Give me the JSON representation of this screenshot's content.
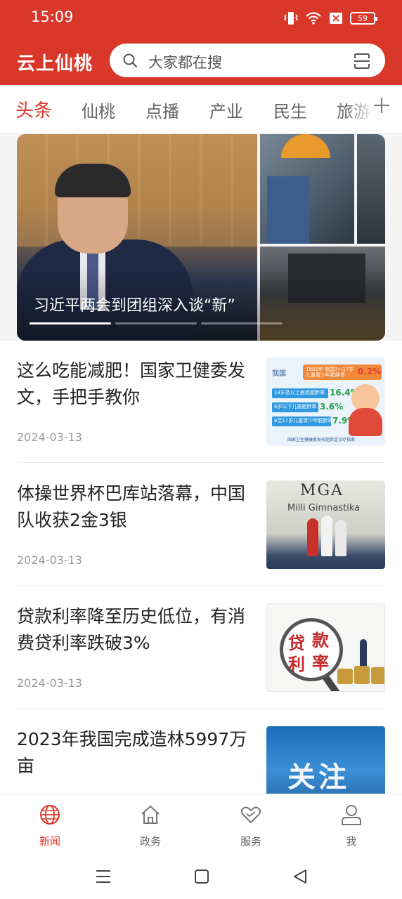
{
  "status_bar": {
    "time": "15:09",
    "battery": "59",
    "icons": [
      "vibrate-icon",
      "wifi-icon",
      "sim-off-icon",
      "battery-icon"
    ]
  },
  "header": {
    "app_title": "云上仙桃",
    "search_placeholder": "大家都在搜",
    "colors": {
      "brand": "#d8372a"
    }
  },
  "tabs": {
    "items": [
      "头条",
      "仙桃",
      "点播",
      "产业",
      "民生",
      "旅游"
    ],
    "active_index": 0
  },
  "carousel": {
    "caption": "习近平两会到团组深入谈“新”",
    "slide_count": 3,
    "active_slide": 0
  },
  "news": [
    {
      "title": "这么吃能减肥！国家卫健委发文，手把手教你",
      "date": "2024-03-13",
      "thumb": {
        "label": "我国",
        "header": "1982年 我国7～17岁儿童青少年肥胖率",
        "header_value": "0.2%",
        "rows": [
          {
            "label": "18岁及以上居民肥胖率",
            "value": "16.4%"
          },
          {
            "label": "6岁以下儿童肥胖率",
            "value": "3.6%"
          },
          {
            "label": "6至17岁儿童青少年肥胖率",
            "value": "7.9%"
          }
        ],
        "footer": "国家卫生健康委发布肥胖症诊疗指南"
      }
    },
    {
      "title": "体操世界杯巴库站落幕，中国队收获2金3银",
      "date": "2024-03-13",
      "thumb": {
        "logo": "MGA",
        "subtitle": "Milli Gimnastika"
      }
    },
    {
      "title": "贷款利率降至历史低位，有消费贷利率跌破3%",
      "date": "2024-03-13",
      "thumb": {
        "chars": [
          "贷",
          "款",
          "利",
          "率"
        ]
      }
    },
    {
      "title": "2023年我国完成造林5997万亩",
      "date": "",
      "thumb": {
        "word": "关注"
      }
    }
  ],
  "bottom_nav": {
    "items": [
      {
        "label": "新闻",
        "icon": "globe-icon"
      },
      {
        "label": "政务",
        "icon": "home-icon"
      },
      {
        "label": "服务",
        "icon": "heart-icon"
      },
      {
        "label": "我",
        "icon": "user-icon"
      }
    ],
    "active_index": 0
  },
  "system_nav": [
    "menu-icon",
    "home-square-icon",
    "back-triangle-icon"
  ]
}
